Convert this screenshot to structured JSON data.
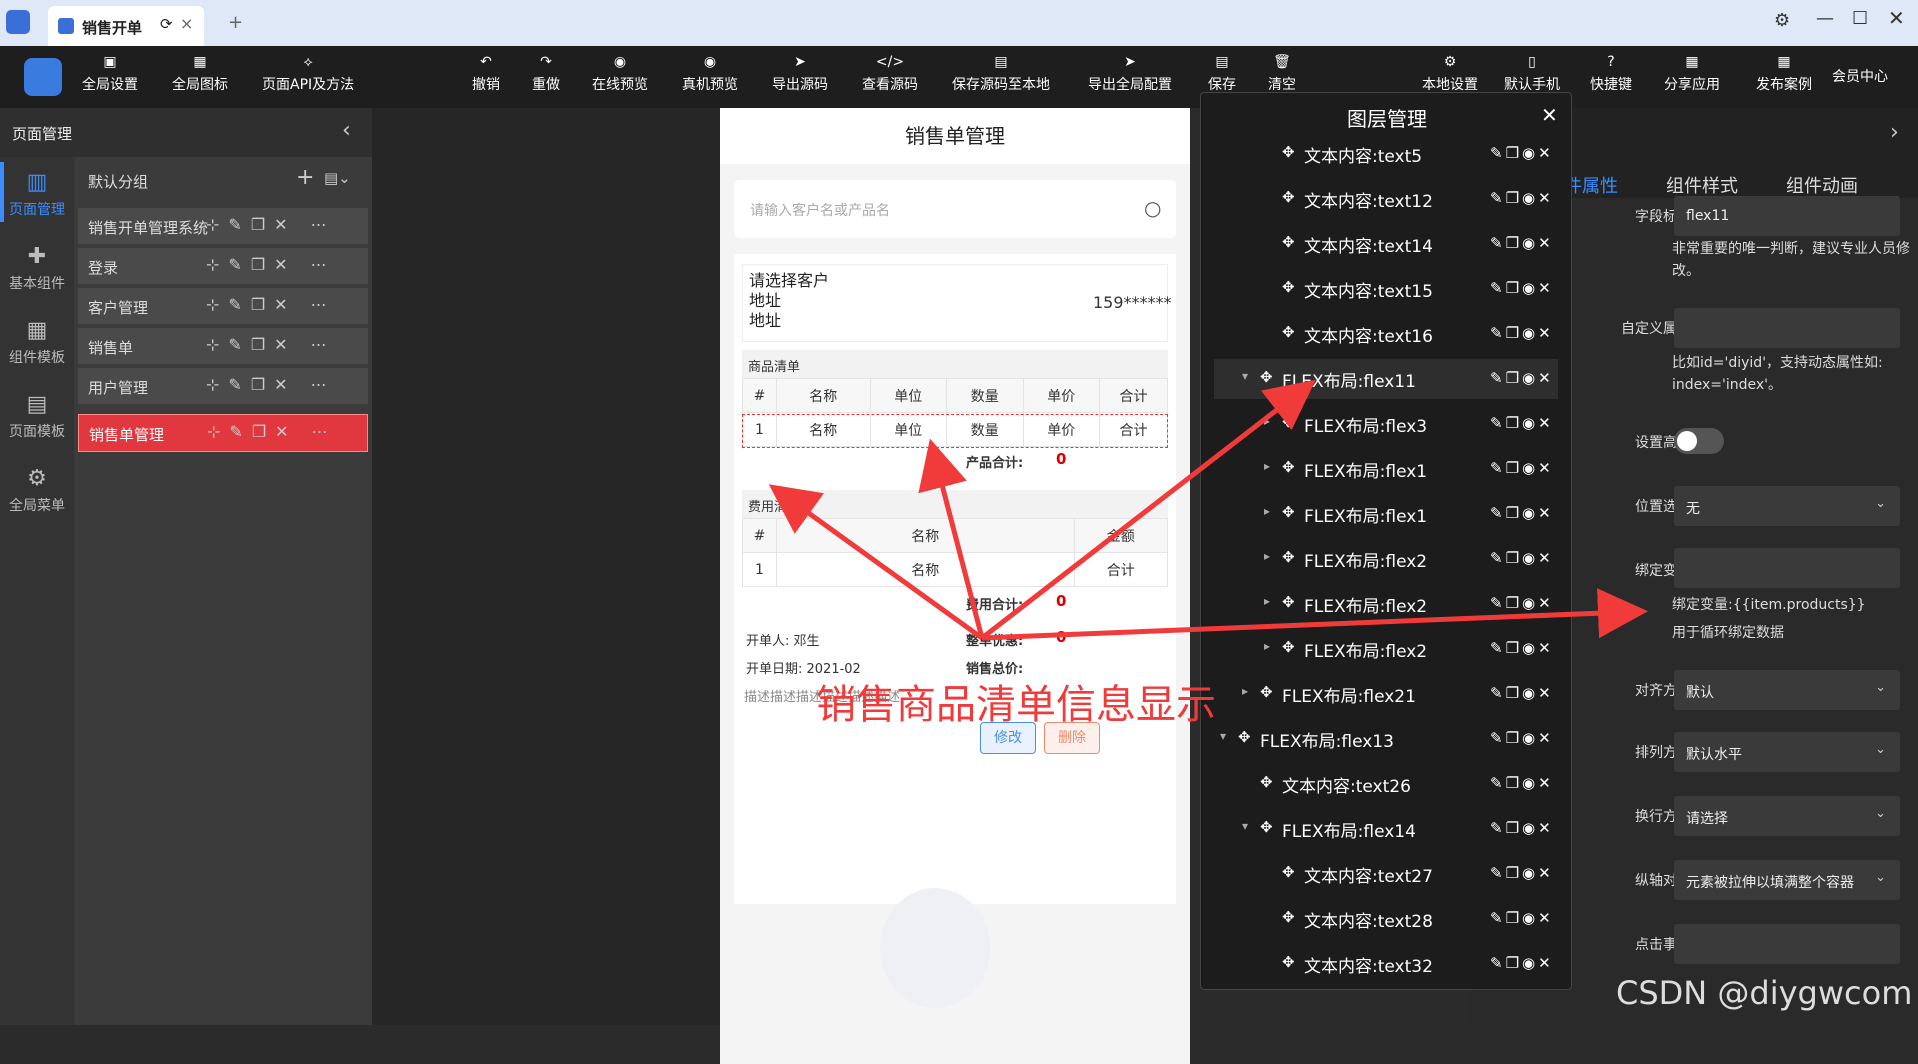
{
  "window": {
    "tab_title": "销售开单",
    "tab_close": "×",
    "tab_add": "+"
  },
  "toolbar": {
    "left": [
      {
        "label": "全局设置",
        "icon": "settings-icon"
      },
      {
        "label": "全局图标",
        "icon": "image-icon"
      },
      {
        "label": "页面API及方法",
        "icon": "api-icon"
      }
    ],
    "center": [
      {
        "label": "撤销",
        "icon": "undo-icon"
      },
      {
        "label": "重做",
        "icon": "redo-icon"
      },
      {
        "label": "在线预览",
        "icon": "eye-icon"
      },
      {
        "label": "真机预览",
        "icon": "eye-icon"
      },
      {
        "label": "导出源码",
        "icon": "send-icon"
      },
      {
        "label": "查看源码",
        "icon": "code-icon"
      },
      {
        "label": "保存源码至本地",
        "icon": "save-icon"
      },
      {
        "label": "导出全局配置",
        "icon": "send-icon"
      },
      {
        "label": "保存",
        "icon": "save-icon"
      },
      {
        "label": "清空",
        "icon": "trash-icon"
      }
    ],
    "right": [
      {
        "label": "本地设置",
        "icon": "gear-icon"
      },
      {
        "label": "默认手机",
        "icon": "phone-icon"
      },
      {
        "label": "快捷键",
        "icon": "help-icon"
      },
      {
        "label": "分享应用",
        "icon": "share-icon"
      },
      {
        "label": "发布案例",
        "icon": "publish-icon"
      }
    ],
    "member": "会员中心"
  },
  "leftnav": [
    {
      "label": "页面管理",
      "icon": "pages-icon",
      "active": true
    },
    {
      "label": "基本组件",
      "icon": "puzzle-icon"
    },
    {
      "label": "组件模板",
      "icon": "template-icon"
    },
    {
      "label": "页面模板",
      "icon": "database-icon"
    },
    {
      "label": "全局菜单",
      "icon": "gear-icon"
    }
  ],
  "pagepanel": {
    "title": "页面管理",
    "group": "默认分组",
    "add": "+",
    "pages": [
      "销售开单管理系统",
      "登录",
      "客户管理",
      "销售单",
      "用户管理",
      "销售单管理"
    ],
    "active_index": 5,
    "ops": "⊹✎❐✕ ⋯"
  },
  "phone": {
    "title": "销售单管理",
    "search_placeholder": "请输入客户名或产品名",
    "customer": {
      "label": "请选择客户",
      "addr1": "地址",
      "addr2": "地址",
      "phone": "159******"
    },
    "goods": {
      "title": "商品清单",
      "headers": [
        "#",
        "名称",
        "单位",
        "数量",
        "单价",
        "合计"
      ],
      "row": [
        "1",
        "名称",
        "单位",
        "数量",
        "单价",
        "合计"
      ],
      "total_label": "产品合计:",
      "total": "0"
    },
    "fees": {
      "title": "费用清单",
      "headers": [
        "#",
        "名称",
        "金额"
      ],
      "row": [
        "1",
        "名称",
        "合计"
      ],
      "total_label": "费用合计:",
      "total": "0"
    },
    "footer": {
      "creator": "开单人: 邓生",
      "date": "开单日期: 2021-02",
      "discount_label": "整单优惠:",
      "discount": "0",
      "sum_label": "销售总价:",
      "desc": "描述描述描述描述描述描述"
    },
    "buttons": {
      "edit": "修改",
      "delete": "删除"
    }
  },
  "layers": {
    "title": "图层管理",
    "items": [
      {
        "label": "文本内容:text5",
        "indent": 2,
        "arrow": ""
      },
      {
        "label": "文本内容:text12",
        "indent": 2,
        "arrow": ""
      },
      {
        "label": "文本内容:text14",
        "indent": 2,
        "arrow": ""
      },
      {
        "label": "文本内容:text15",
        "indent": 2,
        "arrow": ""
      },
      {
        "label": "文本内容:text16",
        "indent": 2,
        "arrow": ""
      },
      {
        "label": "FLEX布局:flex11",
        "indent": 1,
        "arrow": "▾",
        "selected": true
      },
      {
        "label": "FLEX布局:flex3",
        "indent": 2,
        "arrow": "▸"
      },
      {
        "label": "FLEX布局:flex1",
        "indent": 2,
        "arrow": "▸"
      },
      {
        "label": "FLEX布局:flex1",
        "indent": 2,
        "arrow": "▸"
      },
      {
        "label": "FLEX布局:flex2",
        "indent": 2,
        "arrow": "▸"
      },
      {
        "label": "FLEX布局:flex2",
        "indent": 2,
        "arrow": "▸"
      },
      {
        "label": "FLEX布局:flex2",
        "indent": 2,
        "arrow": "▸"
      },
      {
        "label": "FLEX布局:flex21",
        "indent": 1,
        "arrow": "▸"
      },
      {
        "label": "FLEX布局:flex13",
        "indent": 0,
        "arrow": "▾"
      },
      {
        "label": "文本内容:text26",
        "indent": 1,
        "arrow": ""
      },
      {
        "label": "FLEX布局:flex14",
        "indent": 1,
        "arrow": "▾"
      },
      {
        "label": "文本内容:text27",
        "indent": 2,
        "arrow": ""
      },
      {
        "label": "文本内容:text28",
        "indent": 2,
        "arrow": ""
      },
      {
        "label": "文本内容:text32",
        "indent": 2,
        "arrow": ""
      }
    ]
  },
  "props": {
    "tabs": [
      "组件属性",
      "组件样式",
      "组件动画"
    ],
    "field_id_label": "字段标识",
    "field_id": "flex11",
    "field_hint": "非常重要的唯一判断，建议专业人员修改。",
    "custom_attr_label": "自定义属性",
    "custom_hint": "比如id='diyid'，支持动态属性如: index='index'。",
    "height_label": "设置高度",
    "position_label": "位置选择",
    "position": "无",
    "bind_label": "绑定变量",
    "bind_hint1": "绑定变量:{{item.products}}",
    "bind_hint2": "用于循环绑定数据",
    "align_label": "对齐方式",
    "align": "默认",
    "dir_label": "排列方向",
    "dir": "默认水平",
    "wrap_label": "换行方式",
    "wrap": "请选择",
    "cross_label": "纵轴对齐",
    "cross": "元素被拉伸以填满整个容器",
    "click_label": "点击事件"
  },
  "annotation": "销售商品清单信息显示",
  "watermark": "CSDN @diygwcom",
  "colors": {
    "accent": "#e0383e",
    "annotation": "#f13a3a",
    "edit_btn": "#4a90e2",
    "delete_btn": "#f08a6a"
  }
}
